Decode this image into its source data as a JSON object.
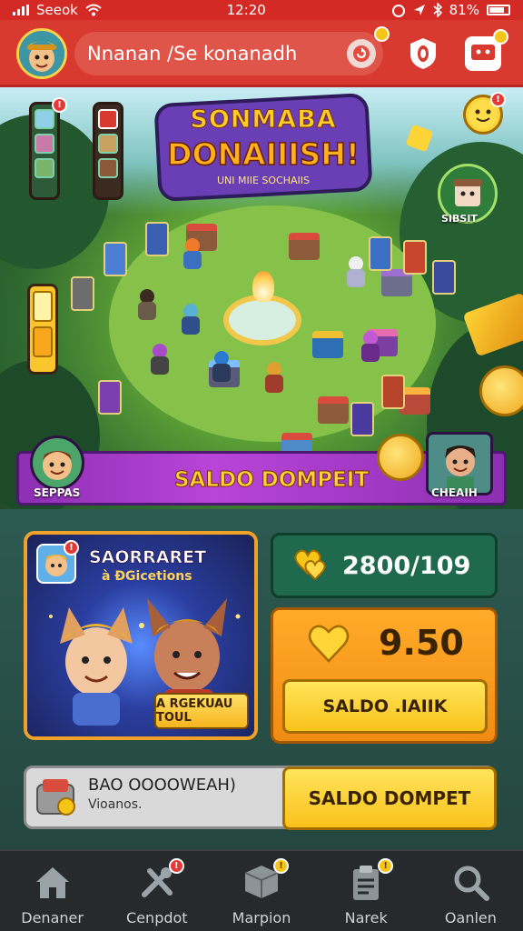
{
  "status": {
    "carrier": "Seeok",
    "time": "12:20",
    "battery": "81%"
  },
  "header": {
    "search_text": "Nnanan /Se konanadh",
    "search_button_badge": "",
    "icon_badges": [
      "",
      ""
    ]
  },
  "game": {
    "logo_line1": "SONMABA",
    "logo_line2": "DONAIIISH!",
    "logo_tagline": "UNI MIIE SOCHAIIS",
    "side_badge": "!",
    "player_right_label": "SIBSIT",
    "banner_text": "SALDO DOMPEIT",
    "banner_left_label": "SEPPAS",
    "banner_right_label": "CHEAIH"
  },
  "event": {
    "title": "SAORRARET",
    "subtitle": "à ĐGicetions",
    "button": "A RGEKUAU TOUL"
  },
  "wallet": {
    "gems": "2800/109",
    "coins": "9.50",
    "coins_button": "SALDO .IAIIK"
  },
  "bottom_bar": {
    "line1": "BAO OOOOWEAH)",
    "line2": "Vioanos.",
    "button": "SALDO DOMPET"
  },
  "nav": [
    {
      "label": "Denaner",
      "icon": "home-icon",
      "badge": ""
    },
    {
      "label": "Cenpdot",
      "icon": "tools-icon",
      "badge": "!"
    },
    {
      "label": "Marpion",
      "icon": "box-icon",
      "badge": "!"
    },
    {
      "label": "Narek",
      "icon": "clipboard-icon",
      "badge": "!"
    },
    {
      "label": "Oanlen",
      "icon": "search-icon",
      "badge": ""
    }
  ],
  "colors": {
    "header_red": "#d93a30",
    "banner_purple": "#b845d8",
    "gold": "#ffd436",
    "gem_box": "#1f6a4e",
    "coin_box": "#f08b12",
    "nav_bg": "#262a2c"
  }
}
